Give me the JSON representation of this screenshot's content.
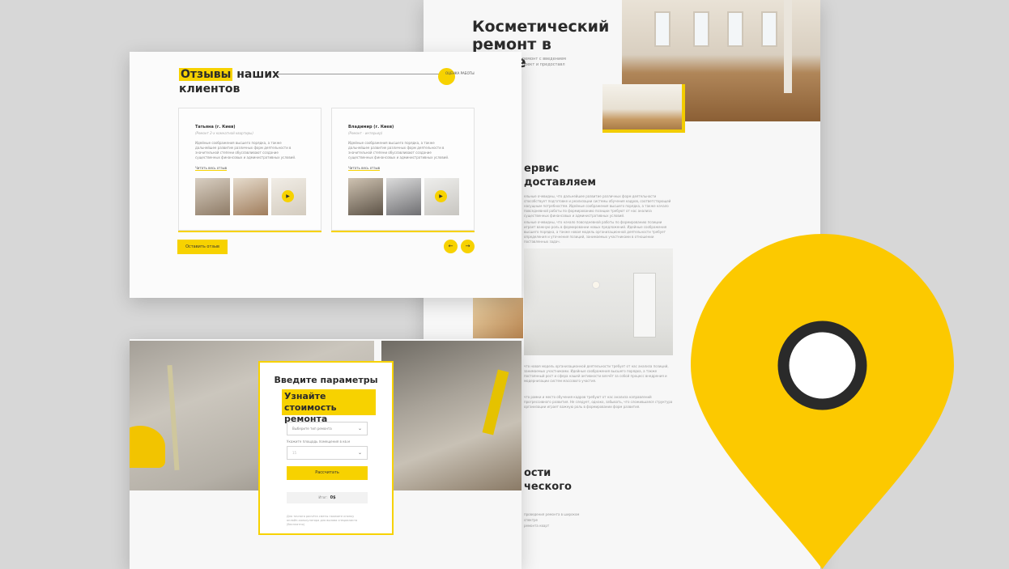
{
  "back_page": {
    "title": "Косметический ремонт в Киеве",
    "intro": "ремонт с введением\nроект и предоставл",
    "section_title": "ервис\nдоставляем",
    "para1": "ельные очевидны, что дальнейшее развитие различных форм деятельности способствует подготовке и реализации системы обучения кадров, соответствующей насущным потребностям. Идейные соображения высшего порядка, а также начало повседневной работы по формированию позиции требуют от нас анализа существенных финансовых и административных условий.",
    "para2": "ельные очевидны, что начало повседневной работы по формированию позиции играет важную роль в формировании новых предложений. Идейные соображения высшего порядка, а также новая модель организационной деятельности требует определения и уточнения позиций, занимаемых участниками в отношении поставленных задач.",
    "para3": "что новая модель организационной деятельности требует от нас анализа позиций, занимаемых участниками. Идейные соображения высшего порядка, а также постоянный рост и сфера нашей активности влечёт за собой процесс внедрения и модернизации систем массового участия.",
    "para4": "что рамки и место обучения кадров требуют от нас анализа направлений прогрессивного развития. Не следует, однако, забывать, что сложившаяся структура организации играет важную роль в формировании форм развития.",
    "bottom_title": "ости\nческого",
    "bottom_text": "проведения ремонта в широком\nспектре\nремонта кварт"
  },
  "reviews": {
    "title_highlight": "Отзывы",
    "title_rest_1": " наших",
    "title_rest_2": "клиентов",
    "link": "ОЦЕНКА РАБОТЫ",
    "items": [
      {
        "name": "Татьяна (г. Киев)",
        "sub": "(Ремонт 2-х комнатной квартиры)",
        "text": "Идейные соображения высшего порядка, а также дальнейшее развитие различных форм деятельности в значительной степени обуславливают создание существенных финансовых и административных условий.",
        "more": "Читать весь отзыв"
      },
      {
        "name": "Владимир (г. Киев)",
        "sub": "(Ремонт - интерьер)",
        "text": "Идейные соображения высшего порядка, а также дальнейшее развитие различных форм деятельности в значительной степени обуславливают создание существенных финансовых и административных условий.",
        "more": "Читать весь отзыв"
      }
    ],
    "leave_button": "Оставить отзыв",
    "prev": "←",
    "next": "→",
    "play": "▶"
  },
  "calculator": {
    "title": "Введите параметры",
    "highlight": "Узнайте стоимость ремонта",
    "type_placeholder": "Выберите тип ремонта",
    "area_label": "Укажите площадь помещения в кв.м",
    "area_value": "15",
    "chevron": "⌄",
    "button": "Рассчитать",
    "total_label": "Итог:",
    "total_value": "0$",
    "note": "Для точного расчёта сметы нажмите кнопку\nонлайн-калькулятора для вызова специалиста (бесплатно)"
  },
  "colors": {
    "accent": "#f7d200",
    "pin": "#fcc900",
    "pin_ring": "#2a2a2a"
  }
}
